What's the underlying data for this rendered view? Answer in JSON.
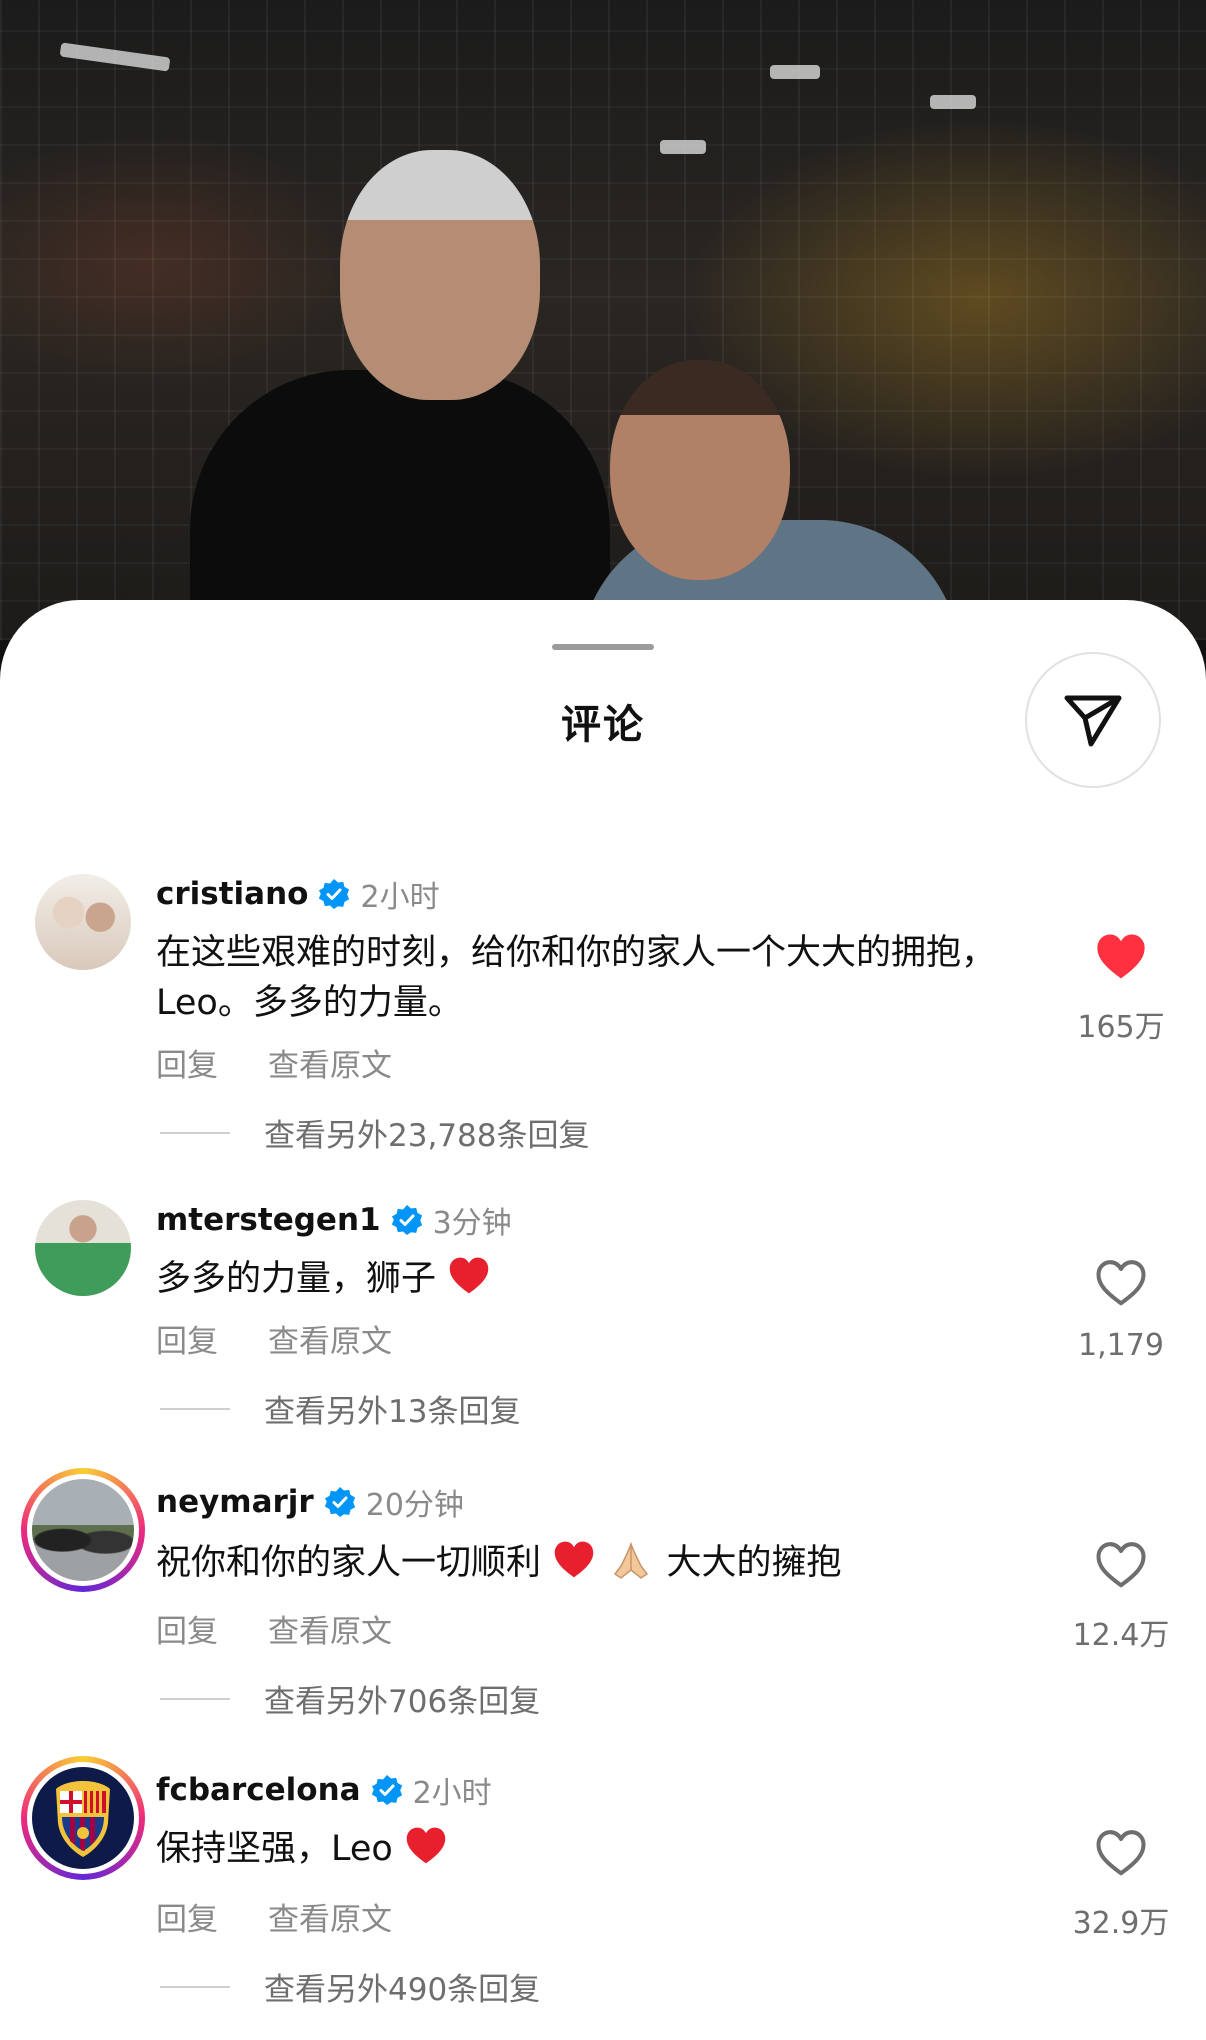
{
  "sheet": {
    "title": "评论"
  },
  "comments": [
    {
      "username": "cristiano",
      "time": "2小时",
      "text": "在这些艰难的时刻，给你和你的家人一个大大的拥抱，Leo。多多的力量。",
      "reply_label": "回复",
      "translate_label": "查看原文",
      "more_replies": "查看另外23,788条回复",
      "likes": "165万",
      "liked": true
    },
    {
      "username": "mterstegen1",
      "time": "3分钟",
      "text": "多多的力量，狮子",
      "reply_label": "回复",
      "translate_label": "查看原文",
      "more_replies": "查看另外13条回复",
      "likes": "1,179",
      "liked": false
    },
    {
      "username": "neymarjr",
      "time": "20分钟",
      "text_a": "祝你和你的家人一切顺利",
      "text_b": "大大的擁抱",
      "reply_label": "回复",
      "translate_label": "查看原文",
      "more_replies": "查看另外706条回复",
      "likes": "12.4万",
      "liked": false
    },
    {
      "username": "fcbarcelona",
      "time": "2小时",
      "text": "保持坚强，Leo",
      "reply_label": "回复",
      "translate_label": "查看原文",
      "more_replies": "查看另外490条回复",
      "likes": "32.9万",
      "liked": false
    }
  ],
  "colors": {
    "like_red": "#ff3040",
    "verified_blue": "#0095f6",
    "muted": "#8a8a8a"
  },
  "icons": [
    "send-icon",
    "verified-badge-icon",
    "heart-filled-icon",
    "heart-outline-icon",
    "red-heart-emoji",
    "folded-hands-emoji"
  ]
}
